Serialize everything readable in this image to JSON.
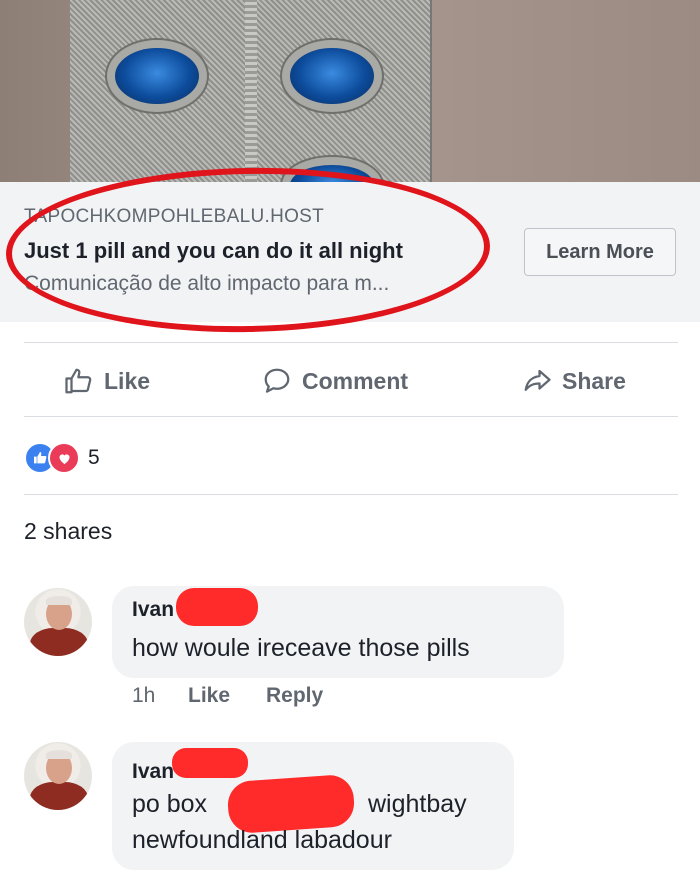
{
  "ad": {
    "domain": "TAPOCHKOMPOHLEBALU.HOST",
    "headline": "Just 1 pill and you can do it all night",
    "description": "Comunicação de alto impacto para m...",
    "cta": "Learn More"
  },
  "actions": {
    "like": "Like",
    "comment": "Comment",
    "share": "Share"
  },
  "reactions": {
    "count": "5"
  },
  "shares_text": "2 shares",
  "comments": [
    {
      "name": "Ivan",
      "text": "how woule ireceave those pills",
      "time": "1h",
      "like": "Like",
      "reply": "Reply"
    },
    {
      "name": "Ivan",
      "line1_a": "po box",
      "line1_b": "wightbay",
      "line2": "newfoundland labadour"
    }
  ],
  "colors": {
    "annotation_red": "#e0141b",
    "link_box_bg": "#f2f3f5",
    "secondary_text": "#606770",
    "primary_text": "#1d2129",
    "like_blue": "#3b82f0",
    "love_red": "#ea3b58"
  }
}
